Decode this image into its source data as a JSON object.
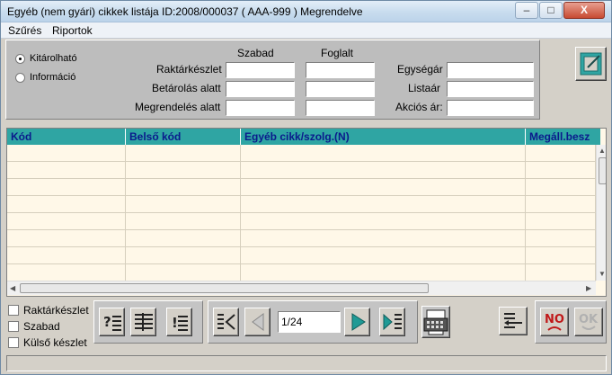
{
  "window": {
    "title": "Egyéb (nem gyári) cikkek listája  ID:2008/000037 ( AAA-999    )  Megrendelve",
    "minimize": "–",
    "maximize": "□",
    "close": "X"
  },
  "menu": {
    "items": [
      "Szűrés",
      "Riportok"
    ]
  },
  "filter": {
    "radios": [
      {
        "label": "Kitárolható",
        "selected": true
      },
      {
        "label": "Információ",
        "selected": false
      }
    ],
    "columns": {
      "free": "Szabad",
      "reserved": "Foglalt"
    },
    "rows": [
      "Raktárkészlet",
      "Betárolás alatt",
      "Megrendelés alatt"
    ],
    "prices": [
      "Egységár",
      "Listaár",
      "Akciós ár:"
    ]
  },
  "grid": {
    "headers": [
      "Kód",
      "Belső kód",
      "Egyéb cikk/szolg.(N)",
      "Megáll.besz"
    ],
    "header_color": "#2fa5a3",
    "row_color": "#fff8e8",
    "rows": 8
  },
  "checkboxes": [
    "Raktárkészlet",
    "Szabad",
    "Külső készlet"
  ],
  "pager": {
    "value": "1/24"
  },
  "buttons": {
    "no_label": "NO",
    "ok_label": "OK"
  }
}
